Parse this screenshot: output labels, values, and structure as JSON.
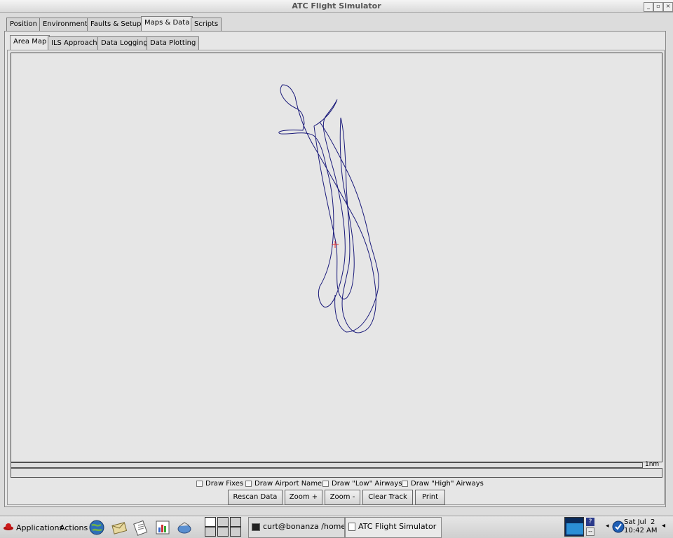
{
  "window": {
    "title": "ATC Flight Simulator",
    "controls": [
      "_",
      "▫",
      "×"
    ]
  },
  "main_tabs": [
    {
      "label": "Position",
      "active": false
    },
    {
      "label": "Environment",
      "active": false
    },
    {
      "label": "Faults & Setup",
      "active": false
    },
    {
      "label": "Maps & Data",
      "active": true
    },
    {
      "label": "Scripts",
      "active": false
    }
  ],
  "sub_tabs": [
    {
      "label": "Area Map",
      "active": true
    },
    {
      "label": "ILS Approach",
      "active": false
    },
    {
      "label": "Data Logging",
      "active": false
    },
    {
      "label": "Data Plotting",
      "active": false
    }
  ],
  "map": {
    "scale_label": "1nm",
    "track_color": "#1a1a7a",
    "aircraft_marker_color": "#e03030"
  },
  "options": [
    {
      "label": "Draw Fixes",
      "checked": false
    },
    {
      "label": "Draw Airport Names",
      "checked": false
    },
    {
      "label": "Draw \"Low\" Airways",
      "checked": false
    },
    {
      "label": "Draw \"High\" Airways",
      "checked": false
    }
  ],
  "buttons": {
    "rescan": "Rescan Data",
    "zoom_in": "Zoom +",
    "zoom_out": "Zoom -",
    "clear_track": "Clear Track",
    "print": "Print"
  },
  "taskbar": {
    "applications": "Applications",
    "actions": "Actions",
    "launchers": [
      "globe-icon",
      "mail-icon",
      "writer-icon",
      "chart-icon",
      "presentation-icon"
    ],
    "tasks": [
      {
        "label": "curt@bonanza  /home/curt/",
        "active": false
      },
      {
        "label": "ATC Flight Simulator",
        "active": true
      }
    ],
    "clock_day": "Sat Jul  2",
    "clock_time": "10:42 AM"
  }
}
